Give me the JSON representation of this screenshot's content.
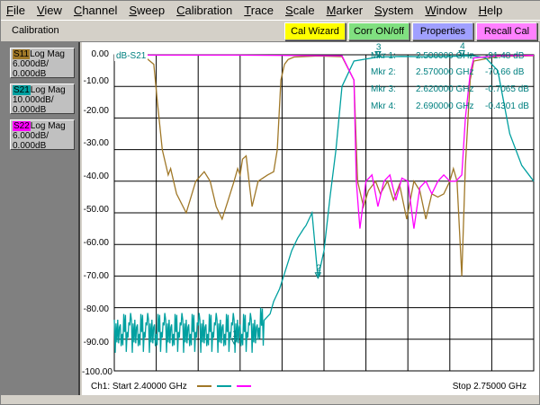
{
  "menu": [
    {
      "u": "F",
      "rest": "ile"
    },
    {
      "u": "V",
      "rest": "iew"
    },
    {
      "u": "C",
      "rest": "hannel"
    },
    {
      "u": "S",
      "rest": "weep"
    },
    {
      "u": "C",
      "rest": "alibration"
    },
    {
      "u": "T",
      "rest": "race"
    },
    {
      "u": "S",
      "rest": "cale"
    },
    {
      "u": "M",
      "rest": "arker"
    },
    {
      "u": "S",
      "rest": "ystem"
    },
    {
      "u": "W",
      "rest": "indow"
    },
    {
      "u": "H",
      "rest": "elp"
    }
  ],
  "toolbar": {
    "title": "Calibration",
    "cal_wizard": "Cal Wizard",
    "corr_onoff": "Corr ON/off",
    "properties": "Properties",
    "recall_cal": "Recall Cal",
    "colors": {
      "cal_wizard": "#ffff00",
      "corr_onoff": "#80e080",
      "properties": "#a0a0ff",
      "recall_cal": "#ff80ff"
    }
  },
  "traces": [
    {
      "tag": "S11",
      "format": "Log Mag",
      "scale": "6.000dB/",
      "ref": "0.000dB",
      "color": "#a07828"
    },
    {
      "tag": "S21",
      "format": "Log Mag",
      "scale": "10.000dB/",
      "ref": "0.000dB",
      "color": "#00a0a0"
    },
    {
      "tag": "S22",
      "format": "Log Mag",
      "scale": "6.000dB/",
      "ref": "0.000dB",
      "color": "#ff00ff"
    }
  ],
  "plot": {
    "active_trace_label": "dB-S21",
    "y_ticks": [
      "0.00",
      "-10.00",
      "-20.00",
      "-30.00",
      "-40.00",
      "-50.00",
      "-60.00",
      "-70.00",
      "-80.00",
      "-90.00",
      "-100.00"
    ],
    "x_start": "Ch1: Start  2.40000 GHz",
    "x_stop": "Stop  2.75000 GHz"
  },
  "markers": [
    {
      "name": "Mkr  1:",
      "freq": "2.500000 GHz",
      "val": "-91.48 dB"
    },
    {
      "name": "Mkr  2:",
      "freq": "2.570000 GHz",
      "val": "-70.66 dB"
    },
    {
      "name": "Mkr  3:",
      "freq": "2.620000 GHz",
      "val": "-0.7065 dB"
    },
    {
      "name": "Mkr  4:",
      "freq": "2.690000 GHz",
      "val": "-0.4301 dB"
    }
  ],
  "marker_flags": [
    "1",
    "2",
    "3",
    "4"
  ],
  "chart_data": {
    "type": "line",
    "x_unit": "GHz",
    "xlim": [
      2.4,
      2.75
    ],
    "ylim": [
      -100,
      0
    ],
    "y_unit": "dB",
    "series": [
      {
        "name": "S11",
        "color": "#a07828",
        "x": [
          2.4,
          2.41,
          2.425,
          2.433,
          2.436,
          2.44,
          2.445,
          2.447,
          2.452,
          2.46,
          2.468,
          2.475,
          2.48,
          2.485,
          2.49,
          2.495,
          2.5,
          2.503,
          2.505,
          2.507,
          2.51,
          2.513,
          2.515,
          2.52,
          2.528,
          2.533,
          2.536,
          2.539,
          2.542,
          2.545,
          2.55,
          2.57,
          2.59,
          2.6,
          2.603,
          2.608,
          2.612,
          2.618,
          2.622,
          2.628,
          2.633,
          2.638,
          2.644,
          2.65,
          2.655,
          2.66,
          2.665,
          2.67,
          2.675,
          2.68,
          2.683,
          2.686,
          2.69,
          2.693,
          2.697,
          2.7,
          2.72,
          2.75
        ],
        "y": [
          -0.2,
          -0.3,
          -0.5,
          -3,
          -15,
          -30,
          -38,
          -36,
          -44,
          -50,
          -40,
          -37,
          -40,
          -48,
          -52,
          -46,
          -40,
          -36,
          -38,
          -33,
          -32,
          -42,
          -48,
          -40,
          -38,
          -37,
          -30,
          -8,
          -3,
          -1.5,
          -0.7,
          -0.4,
          -0.6,
          -8,
          -40,
          -48,
          -43,
          -40,
          -44,
          -40,
          -46,
          -41,
          -52,
          -40,
          -43,
          -52,
          -44,
          -45,
          -44,
          -40,
          -36,
          -40,
          -70,
          -35,
          -8,
          -2,
          -0.5,
          -0.3
        ]
      },
      {
        "name": "S21",
        "color": "#00a0a0",
        "x": [
          2.4,
          2.43,
          2.46,
          2.49,
          2.51,
          2.52,
          2.525,
          2.53,
          2.533,
          2.538,
          2.543,
          2.548,
          2.553,
          2.558,
          2.56,
          2.565,
          2.57,
          2.575,
          2.58,
          2.585,
          2.59,
          2.6,
          2.62,
          2.64,
          2.66,
          2.68,
          2.69,
          2.7,
          2.71,
          2.72,
          2.73,
          2.74,
          2.75
        ],
        "y": [
          -88,
          -88,
          -88,
          -88,
          -88,
          -86,
          -84,
          -82,
          -78,
          -74,
          -68,
          -62,
          -58,
          -55,
          -54,
          -50,
          -70.66,
          -62,
          -45,
          -30,
          -10,
          -2,
          -0.7,
          -0.5,
          -0.6,
          -0.5,
          -0.4,
          -0.3,
          -1,
          -5,
          -25,
          -35,
          -40
        ]
      },
      {
        "name": "S22",
        "color": "#ff00ff",
        "x": [
          2.4,
          2.5,
          2.59,
          2.6,
          2.602,
          2.605,
          2.61,
          2.615,
          2.62,
          2.625,
          2.63,
          2.635,
          2.64,
          2.645,
          2.65,
          2.655,
          2.66,
          2.665,
          2.67,
          2.675,
          2.68,
          2.685,
          2.69,
          2.693,
          2.697,
          2.7,
          2.72,
          2.75
        ],
        "y": [
          -0.1,
          -0.1,
          -0.3,
          -8,
          -40,
          -55,
          -40,
          -38,
          -48,
          -40,
          -38,
          -46,
          -39,
          -40,
          -55,
          -42,
          -40,
          -44,
          -40,
          -38,
          -40,
          -40,
          -38,
          -20,
          -6,
          -1,
          -0.3,
          -0.2
        ]
      }
    ],
    "markers_on": "S21",
    "marker_points": [
      {
        "label": "1",
        "x": 2.5,
        "y": -91.48
      },
      {
        "label": "2",
        "x": 2.57,
        "y": -70.66
      },
      {
        "label": "3",
        "x": 2.62,
        "y": -0.7065
      },
      {
        "label": "4",
        "x": 2.69,
        "y": -0.4301
      }
    ]
  }
}
